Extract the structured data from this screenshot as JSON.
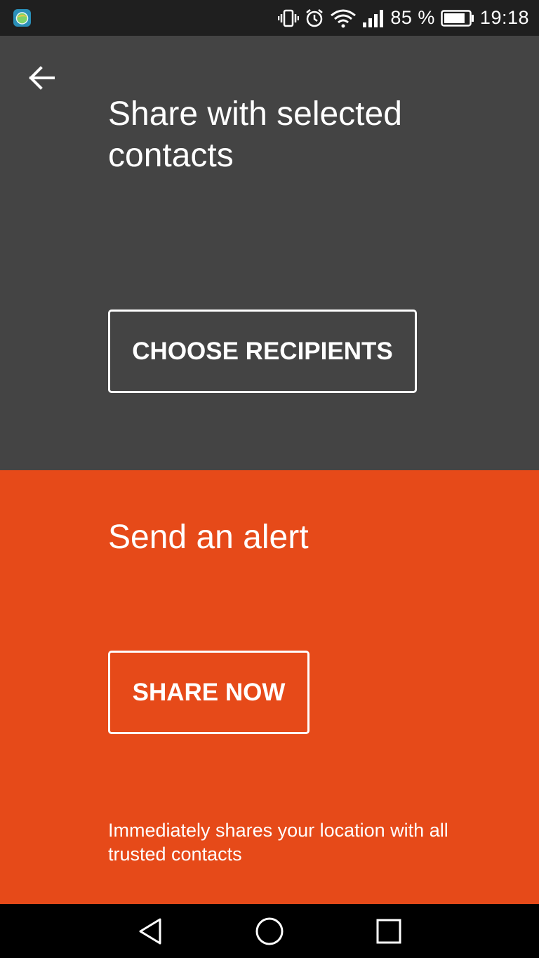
{
  "status_bar": {
    "battery_percent": "85 %",
    "battery_level": 0.85,
    "time": "19:18",
    "icons": [
      "app-notification-icon",
      "vibrate-icon",
      "alarm-icon",
      "wifi-icon",
      "signal-icon",
      "battery-icon"
    ]
  },
  "share_section": {
    "title": "Share with selected contacts",
    "choose_button_label": "CHOOSE RECIPIENTS",
    "background_color": "#444444"
  },
  "alert_section": {
    "title": "Send an alert",
    "share_now_label": "SHARE NOW",
    "description": "Immediately shares your location with all trusted contacts",
    "background_color": "#e64a19"
  },
  "navigation": {
    "back_icon": "arrow-left-icon",
    "system_icons": [
      "nav-back-icon",
      "nav-home-icon",
      "nav-recents-icon"
    ]
  }
}
